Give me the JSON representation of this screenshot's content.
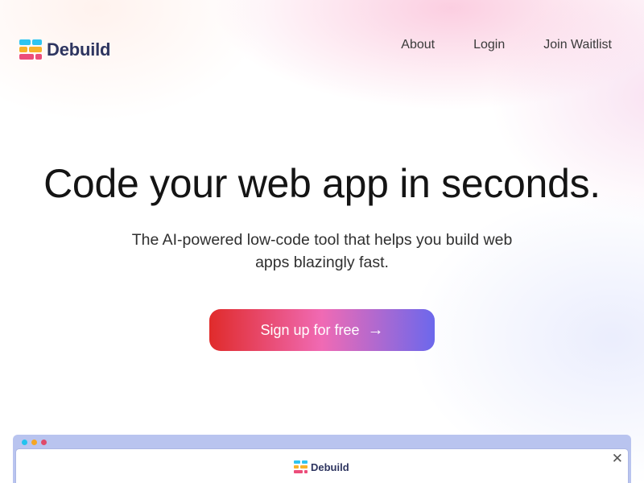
{
  "header": {
    "brand": "Debuild",
    "nav": [
      {
        "label": "About"
      },
      {
        "label": "Login"
      },
      {
        "label": "Join Waitlist"
      }
    ]
  },
  "hero": {
    "headline": "Code your web app in seconds.",
    "subheadline": "The AI-powered low-code tool that helps you build web apps blazingly fast.",
    "cta_label": "Sign up for free",
    "cta_arrow": "→"
  },
  "preview": {
    "brand": "Debuild",
    "close_glyph": "✕",
    "window_dot_colors": [
      "#22c3ef",
      "#f5a623",
      "#e04a6a"
    ]
  },
  "colors": {
    "brand_text": "#2e3560",
    "cta_gradient": [
      "#e02b2b",
      "#f06ab4",
      "#6c68ec"
    ],
    "logo_bars": [
      "#2ec4f1",
      "#f7b32b",
      "#ec4d7a"
    ]
  },
  "icons": [
    "debuild-logo-icon",
    "arrow-right-icon",
    "close-icon"
  ]
}
